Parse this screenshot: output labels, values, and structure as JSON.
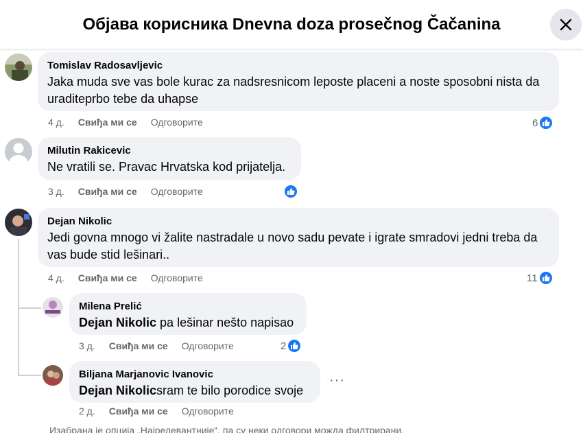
{
  "header": {
    "title": "Објава корисника Dnevna doza prosečnog Čačanina",
    "close_icon": "close-icon"
  },
  "labels": {
    "like": "Свиђа ми се",
    "reply": "Одговорите"
  },
  "comments": [
    {
      "author": "Tomislav Radosavljevic",
      "text": "Jaka muda sve vas bole kurac za nadsresnicom leposte placeni a noste sposobni nista da uraditeprbo tebe da uhapse",
      "time": "4 д.",
      "reactions": "6"
    },
    {
      "author": "Milutin Rakicevic",
      "text": "Ne vratili se. Pravac Hrvatska kod prijatelja.",
      "time": "3 д.",
      "reactions": ""
    },
    {
      "author": "Dejan Nikolic",
      "text": "Jedi govna mnogo vi žalite nastradale u novo sadu pevate i igrate smradovi jedni treba da vas bude stid lešinari..",
      "time": "4 д.",
      "reactions": "11"
    }
  ],
  "replies": [
    {
      "author": "Milena Prelić",
      "mention": "Dejan Nikolic",
      "text": " pa lešinar nešto napisao",
      "time": "3 д.",
      "reactions": "2"
    },
    {
      "author": "Biljana Marjanovic Ivanovic",
      "mention": "Dejan Nikolic",
      "text": "sram te bilo porodice svoje",
      "time": "2 д.",
      "reactions": ""
    }
  ],
  "footer": {
    "note": "Изабрана је опција „Најрелевантније“, па су неки одговори можда филтрирани."
  },
  "colors": {
    "accent": "#1877f2",
    "bubble": "#f0f2f5",
    "secondary_text": "#65676b"
  }
}
